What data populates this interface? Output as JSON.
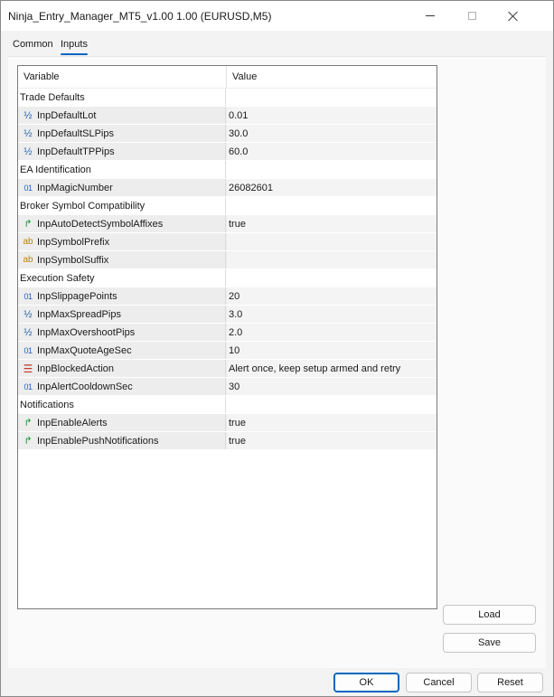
{
  "window": {
    "title": "Ninja_Entry_Manager_MT5_v1.00 1.00 (EURUSD,M5)"
  },
  "tabs": [
    {
      "label": "Common"
    },
    {
      "label": "Inputs"
    }
  ],
  "grid": {
    "headers": {
      "variable": "Variable",
      "value": "Value"
    },
    "rows": [
      {
        "kind": "group",
        "label": "Trade Defaults"
      },
      {
        "kind": "param",
        "icon": "double-icon",
        "name": "InpDefaultLot",
        "value": "0.01"
      },
      {
        "kind": "param",
        "icon": "double-icon",
        "name": "InpDefaultSLPips",
        "value": "30.0"
      },
      {
        "kind": "param",
        "icon": "double-icon",
        "name": "InpDefaultTPPips",
        "value": "60.0"
      },
      {
        "kind": "group",
        "label": "EA Identification"
      },
      {
        "kind": "param",
        "icon": "integer-icon",
        "name": "InpMagicNumber",
        "value": "26082601"
      },
      {
        "kind": "group",
        "label": "Broker Symbol Compatibility"
      },
      {
        "kind": "param",
        "icon": "bool-icon",
        "name": "InpAutoDetectSymbolAffixes",
        "value": "true"
      },
      {
        "kind": "param",
        "icon": "string-icon",
        "name": "InpSymbolPrefix",
        "value": ""
      },
      {
        "kind": "param",
        "icon": "string-icon",
        "name": "InpSymbolSuffix",
        "value": ""
      },
      {
        "kind": "group",
        "label": "Execution Safety"
      },
      {
        "kind": "param",
        "icon": "integer-icon",
        "name": "InpSlippagePoints",
        "value": "20"
      },
      {
        "kind": "param",
        "icon": "double-icon",
        "name": "InpMaxSpreadPips",
        "value": "3.0"
      },
      {
        "kind": "param",
        "icon": "double-icon",
        "name": "InpMaxOvershootPips",
        "value": "2.0"
      },
      {
        "kind": "param",
        "icon": "integer-icon",
        "name": "InpMaxQuoteAgeSec",
        "value": "10"
      },
      {
        "kind": "param",
        "icon": "enum-icon",
        "name": "InpBlockedAction",
        "value": "Alert once, keep setup armed and retry"
      },
      {
        "kind": "param",
        "icon": "integer-icon",
        "name": "InpAlertCooldownSec",
        "value": "30"
      },
      {
        "kind": "group",
        "label": "Notifications"
      },
      {
        "kind": "param",
        "icon": "bool-icon",
        "name": "InpEnableAlerts",
        "value": "true"
      },
      {
        "kind": "param",
        "icon": "bool-icon",
        "name": "InpEnablePushNotifications",
        "value": "true"
      }
    ]
  },
  "icon_glyphs": {
    "double-icon": "½",
    "integer-icon": "01",
    "bool-icon": "↱",
    "string-icon": "ab",
    "enum-icon": "☰"
  },
  "buttons": {
    "load": "Load",
    "save": "Save",
    "ok": "OK",
    "cancel": "Cancel",
    "reset": "Reset"
  }
}
